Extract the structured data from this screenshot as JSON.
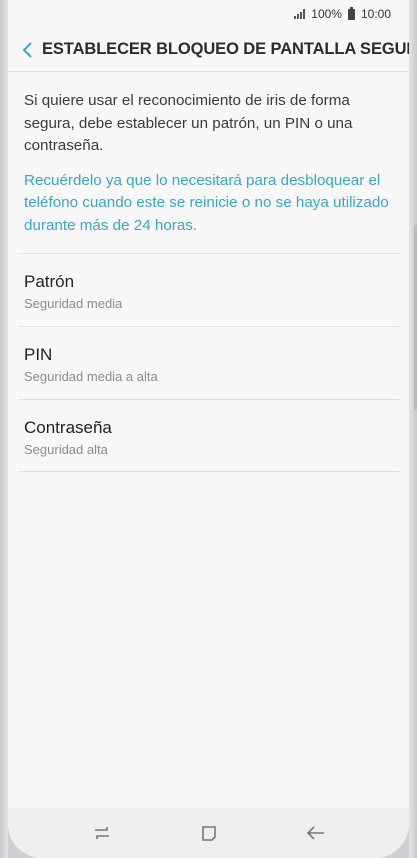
{
  "status_bar": {
    "battery": "100%",
    "time": "10:00"
  },
  "app_bar": {
    "title": "ESTABLECER BLOQUEO DE PANTALLA SEGURO"
  },
  "content": {
    "description": "Si quiere usar el reconocimiento de iris de forma segura, debe establecer un patrón, un PIN o una contraseña.",
    "notice": "Recuérdelo ya que lo necesitará para desbloquear el teléfono cuando este se reinicie o no se haya utilizado durante más de 24 horas."
  },
  "options": [
    {
      "title": "Patrón",
      "subtitle": "Seguridad media"
    },
    {
      "title": "PIN",
      "subtitle": "Seguridad media a alta"
    },
    {
      "title": "Contraseña",
      "subtitle": "Seguridad alta"
    }
  ],
  "colors": {
    "accent": "#3aa6c2",
    "background": "#f8f8f8"
  },
  "nav_icons": [
    "recent-apps-icon",
    "home-icon",
    "back-icon"
  ]
}
